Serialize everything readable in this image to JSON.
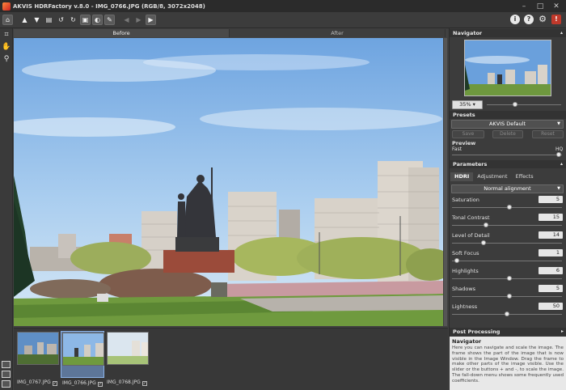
{
  "window": {
    "title": "AKVIS HDRFactory v.8.0 - IMG_0766.JPG (RGB/8, 3072x2048)",
    "minimize": "–",
    "maximize": "□",
    "close": "✕"
  },
  "toolbar": {
    "left_icons": [
      "home-icon",
      "open-icon",
      "save-icon",
      "print-icon",
      "undo-icon",
      "redo-icon",
      "batch-icon",
      "compare-icon",
      "settings-toggle-icon",
      "back-icon",
      "forward-icon",
      "run-icon"
    ],
    "info": "i",
    "help": "?",
    "gear": "⚙",
    "hdr": "!"
  },
  "view_tabs": {
    "before": "Before",
    "after": "After"
  },
  "filmstrip": [
    {
      "name": "IMG_0767.JPG",
      "checked": true,
      "selected": false
    },
    {
      "name": "IMG_0766.JPG",
      "checked": true,
      "selected": true
    },
    {
      "name": "IMG_0768.JPG",
      "checked": true,
      "selected": false
    }
  ],
  "navigator": {
    "header": "Navigator",
    "zoom": "35%",
    "zoom_level": 0.35
  },
  "presets": {
    "header": "Presets",
    "selected": "AKVIS Default",
    "save": "Save",
    "delete": "Delete",
    "reset": "Reset"
  },
  "preview": {
    "label": "Preview",
    "fast": "Fast",
    "hq": "HQ"
  },
  "parameters": {
    "header": "Parameters",
    "tabs": [
      "HDRI",
      "Adjustment",
      "Effects"
    ],
    "active_tab": "HDRI",
    "alignment": "Normal alignment",
    "items": [
      {
        "label": "Saturation",
        "value": "5",
        "fraction": 0.52
      },
      {
        "label": "Tonal Contrast",
        "value": "15",
        "fraction": 0.3
      },
      {
        "label": "Level of Detail",
        "value": "14",
        "fraction": 0.28
      },
      {
        "label": "Soft Focus",
        "value": "1",
        "fraction": 0.02
      },
      {
        "label": "Highlights",
        "value": "6",
        "fraction": 0.52
      },
      {
        "label": "Shadows",
        "value": "5",
        "fraction": 0.52
      },
      {
        "label": "Lightness",
        "value": "50",
        "fraction": 0.5
      }
    ]
  },
  "post_processing": {
    "header": "Post Processing"
  },
  "help": {
    "title": "Navigator",
    "text": "Here you can navigate and scale the image. The frame shows the part of the image that is now visible in the Image Window. Drag the frame to make other parts of the image visible. Use the slider or the buttons + and -, to scale the image. The fall-down menu shows some frequently used coefficients."
  },
  "colors": {
    "accent": "#8db4e8",
    "panel_bg": "#3c3c3c",
    "header_bg": "#333333"
  }
}
